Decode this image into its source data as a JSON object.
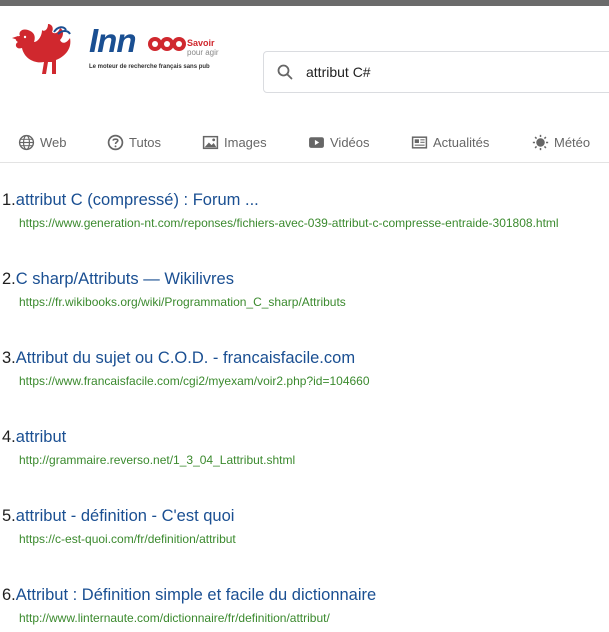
{
  "header": {
    "logo_text": "Innooo",
    "logo_savoir": "Savoir",
    "logo_pour": "pour agir",
    "logo_tagline": "Le moteur de recherche français sans pub",
    "brand_colors": {
      "blue": "#1a4f92",
      "red": "#d0282e"
    }
  },
  "search": {
    "value": "attribut C#",
    "icon": "search-icon"
  },
  "tabs": [
    {
      "label": "Web",
      "icon": "globe-icon"
    },
    {
      "label": "Tutos",
      "icon": "question-circle-icon"
    },
    {
      "label": "Images",
      "icon": "image-icon"
    },
    {
      "label": "Vidéos",
      "icon": "video-play-icon"
    },
    {
      "label": "Actualités",
      "icon": "newspaper-icon"
    },
    {
      "label": "Météo",
      "icon": "sun-icon"
    }
  ],
  "results": [
    {
      "num": "1.",
      "title": "attribut C (compressé) : Forum ...",
      "url": "https://www.generation-nt.com/reponses/fichiers-avec-039-attribut-c-compresse-entraide-301808.html"
    },
    {
      "num": "2.",
      "title": "C sharp/Attributs — Wikilivres",
      "url": "https://fr.wikibooks.org/wiki/Programmation_C_sharp/Attributs"
    },
    {
      "num": "3.",
      "title": "Attribut du sujet ou C.O.D. - francaisfacile.com",
      "url": "https://www.francaisfacile.com/cgi2/myexam/voir2.php?id=104660"
    },
    {
      "num": "4.",
      "title": "attribut",
      "url": "http://grammaire.reverso.net/1_3_04_Lattribut.shtml"
    },
    {
      "num": "5.",
      "title": "attribut - définition - C'est quoi",
      "url": "https://c-est-quoi.com/fr/definition/attribut"
    },
    {
      "num": "6.",
      "title": "Attribut : Définition simple et facile du dictionnaire",
      "url": "http://www.linternaute.com/dictionnaire/fr/definition/attribut/"
    }
  ],
  "colors": {
    "link": "#1a4f92",
    "url": "#3b8a2e",
    "tab_text": "#666666"
  }
}
